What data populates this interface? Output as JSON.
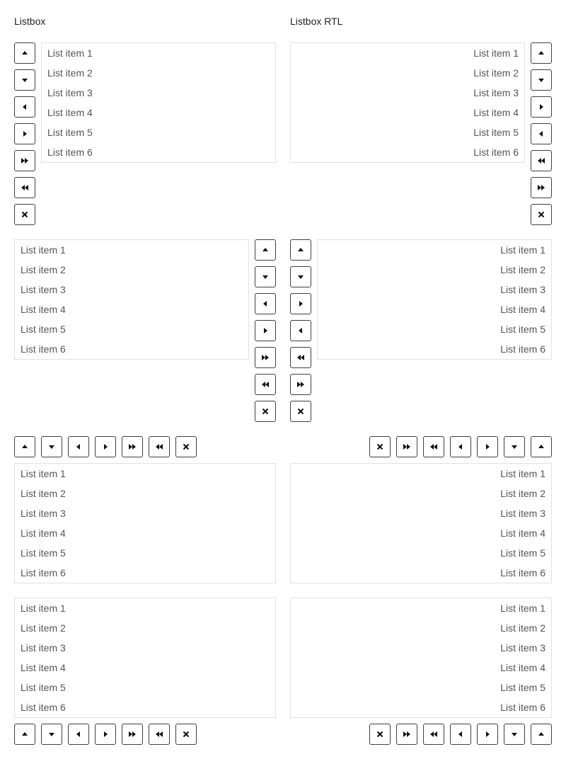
{
  "headings": {
    "left": "Listbox",
    "right": "Listbox RTL"
  },
  "list_items": [
    "List item 1",
    "List item 2",
    "List item 3",
    "List item 4",
    "List item 5",
    "List item 6"
  ],
  "icons": {
    "up": "triangle-up-icon",
    "down": "triangle-down-icon",
    "left": "triangle-left-icon",
    "right": "triangle-right-icon",
    "double_right": "double-triangle-right-icon",
    "double_left": "double-triangle-left-icon",
    "close": "close-x-icon"
  },
  "colors": {
    "border": "#e1e1e1",
    "button_border": "#3f3f3f",
    "text": "#555555"
  }
}
